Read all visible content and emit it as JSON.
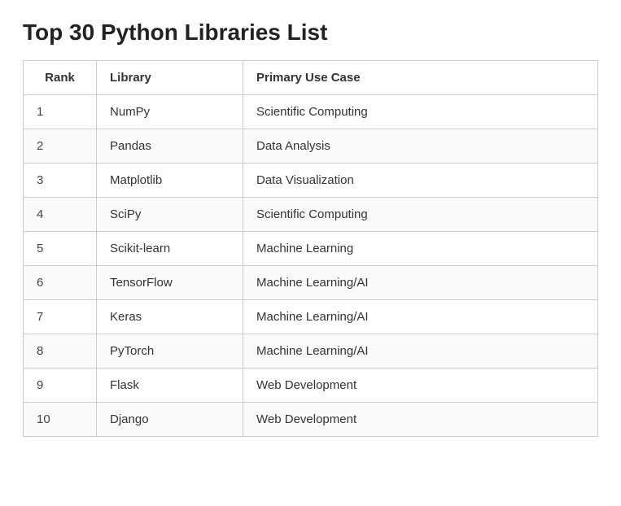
{
  "page": {
    "title": "Top 30 Python Libraries List"
  },
  "table": {
    "columns": [
      {
        "key": "rank",
        "label": "Rank"
      },
      {
        "key": "library",
        "label": "Library"
      },
      {
        "key": "use_case",
        "label": "Primary Use Case"
      }
    ],
    "rows": [
      {
        "rank": "1",
        "library": "NumPy",
        "use_case": "Scientific Computing"
      },
      {
        "rank": "2",
        "library": "Pandas",
        "use_case": "Data Analysis"
      },
      {
        "rank": "3",
        "library": "Matplotlib",
        "use_case": "Data Visualization"
      },
      {
        "rank": "4",
        "library": "SciPy",
        "use_case": "Scientific Computing"
      },
      {
        "rank": "5",
        "library": "Scikit-learn",
        "use_case": "Machine Learning"
      },
      {
        "rank": "6",
        "library": "TensorFlow",
        "use_case": "Machine Learning/AI"
      },
      {
        "rank": "7",
        "library": "Keras",
        "use_case": "Machine Learning/AI"
      },
      {
        "rank": "8",
        "library": "PyTorch",
        "use_case": "Machine Learning/AI"
      },
      {
        "rank": "9",
        "library": "Flask",
        "use_case": "Web Development"
      },
      {
        "rank": "10",
        "library": "Django",
        "use_case": "Web Development"
      }
    ]
  }
}
